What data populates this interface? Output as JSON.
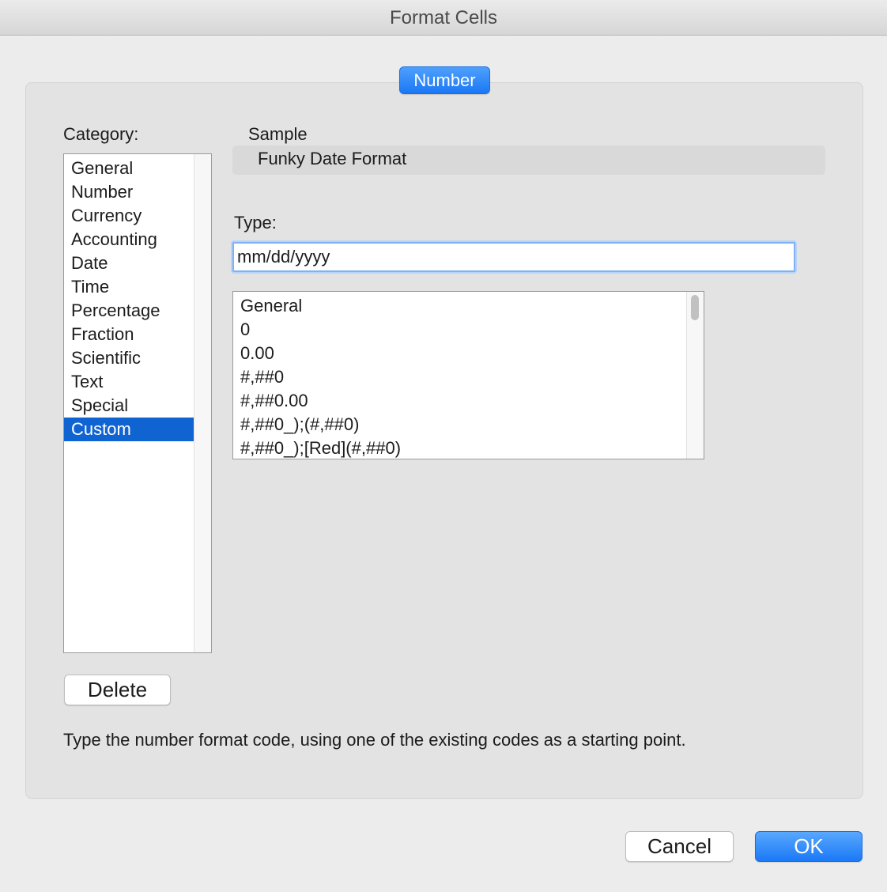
{
  "window": {
    "title": "Format Cells"
  },
  "tab": {
    "label": "Number"
  },
  "category": {
    "label": "Category:",
    "items": [
      "General",
      "Number",
      "Currency",
      "Accounting",
      "Date",
      "Time",
      "Percentage",
      "Fraction",
      "Scientific",
      "Text",
      "Special",
      "Custom"
    ],
    "selected": "Custom"
  },
  "sample": {
    "label": "Sample",
    "value": "Funky Date Format"
  },
  "type": {
    "label": "Type:",
    "value": "mm/dd/yyyy",
    "list": [
      "General",
      "0",
      "0.00",
      "#,##0",
      "#,##0.00",
      "#,##0_);(#,##0)",
      "#,##0_);[Red](#,##0)"
    ]
  },
  "buttons": {
    "delete": "Delete",
    "cancel": "Cancel",
    "ok": "OK"
  },
  "hint": "Type the number format code, using one of the existing codes as a starting point.",
  "colors": {
    "accent": "#1a78f5",
    "selection": "#0f64d2"
  }
}
